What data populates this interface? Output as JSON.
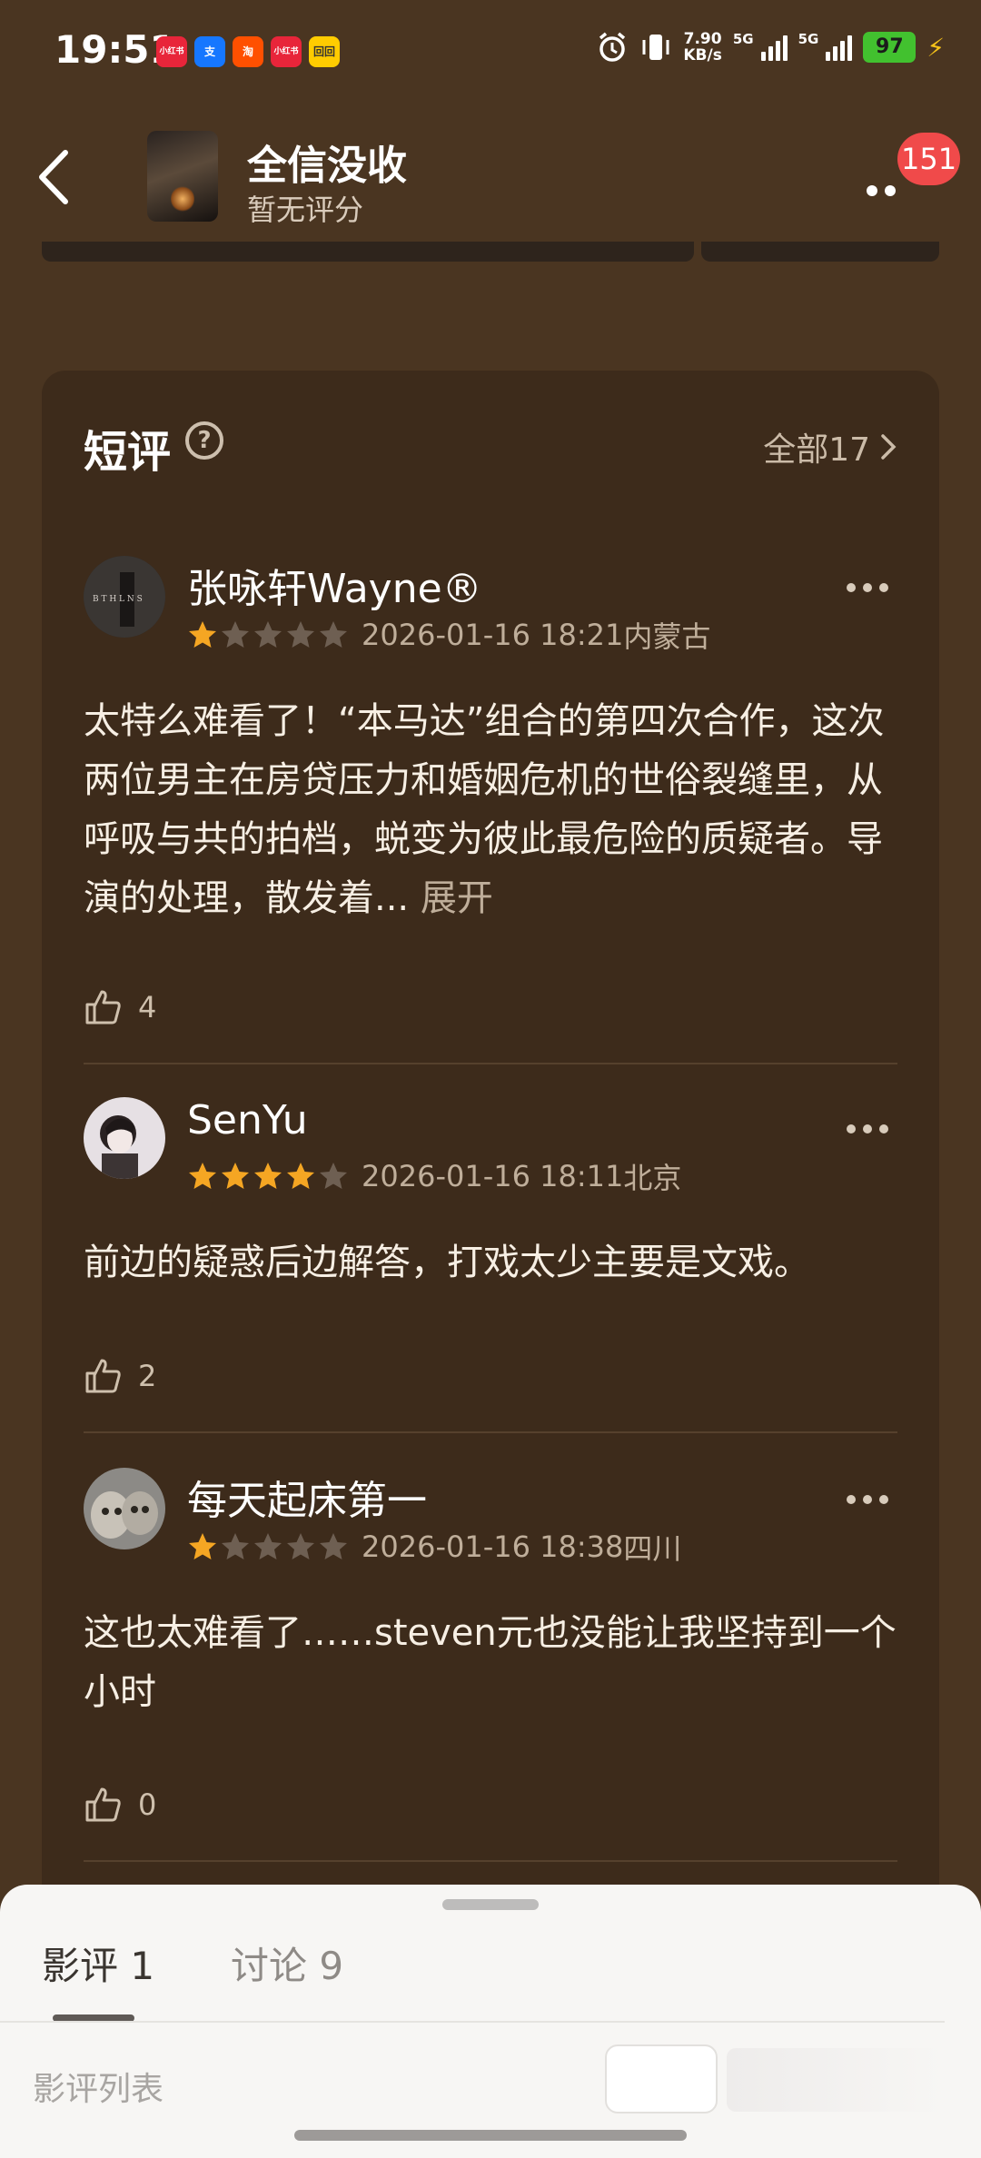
{
  "status_bar": {
    "time": "19:51",
    "app_icons": [
      {
        "label": "小红书",
        "color": "#e8253a"
      },
      {
        "label": "支",
        "color": "#1677ff"
      },
      {
        "label": "淘",
        "color": "#ff5000"
      },
      {
        "label": "小红书",
        "color": "#e8253a"
      },
      {
        "label": "回回",
        "color": "#ffcc00"
      }
    ],
    "net_speed_value": "7.90",
    "net_speed_unit": "KB/s",
    "sim1": "5G",
    "sim2": "5G",
    "battery": "97"
  },
  "header": {
    "movie_title": "全信没收",
    "rating_text": "暂无评分",
    "notification_count": "151"
  },
  "short_reviews": {
    "title": "短评",
    "all_link": "全部17",
    "reviews": [
      {
        "username": "张咏轩Wayne®",
        "stars": 1,
        "datetime": "2026-01-16 18:21",
        "location": "内蒙古",
        "text": "太特么难看了！“本马达”组合的第四次合作，这次两位男主在房贷压力和婚姻危机的世俗裂缝里，从呼吸与共的拍档，蜕变为彼此最危险的质疑者。导演的处理，散发着...",
        "expand": "展开",
        "likes": "4"
      },
      {
        "username": "SenYu",
        "stars": 4,
        "datetime": "2026-01-16 18:11",
        "location": "北京",
        "text": "前边的疑惑后边解答，打戏太少主要是文戏。",
        "likes": "2"
      },
      {
        "username": "每天起床第一",
        "stars": 1,
        "datetime": "2026-01-16 18:38",
        "location": "四川",
        "text": "这也太难看了……steven元也没能让我坚持到一个小时",
        "likes": "0"
      }
    ]
  },
  "bottom_sheet": {
    "tab_reviews": "影评 1",
    "tab_discussion": "讨论 9",
    "list_label": "影评列表"
  },
  "colors": {
    "background": "#4a3521",
    "card": "#3d2b1b",
    "star_on": "#f5a623",
    "star_off": "#6e5f52",
    "badge": "#f04a4a"
  }
}
